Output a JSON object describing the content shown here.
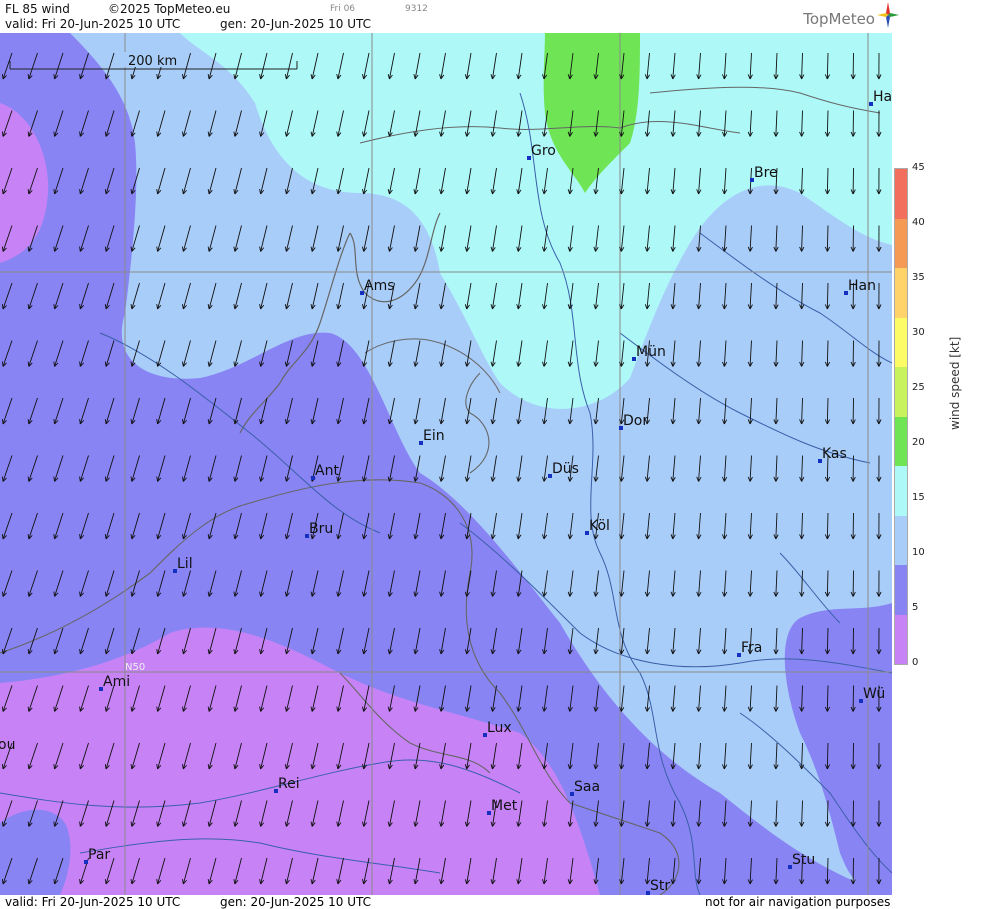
{
  "header": {
    "title": "FL 85 wind",
    "copyright": "©2025 TopMeteo.eu",
    "run_code": "Fri 06",
    "product_code": "9312",
    "valid": "valid:  Fri  20-Jun-2025  10 UTC",
    "generated": "gen:  20-Jun-2025  10 UTC",
    "brand": "TopMeteo"
  },
  "map": {
    "scale_label": "200 km",
    "lat_label": "N50",
    "cities": [
      {
        "code": "Ha"
      },
      {
        "code": "Gro"
      },
      {
        "code": "Bre"
      },
      {
        "code": "Ams"
      },
      {
        "code": "Han"
      },
      {
        "code": "Mün"
      },
      {
        "code": "Dor"
      },
      {
        "code": "Ein"
      },
      {
        "code": "Düs"
      },
      {
        "code": "Kas"
      },
      {
        "code": "Ant"
      },
      {
        "code": "Bru"
      },
      {
        "code": "Köl"
      },
      {
        "code": "Lil"
      },
      {
        "code": "Fra"
      },
      {
        "code": "Ami"
      },
      {
        "code": "Wü"
      },
      {
        "code": "Lux"
      },
      {
        "code": "ou"
      },
      {
        "code": "Rei"
      },
      {
        "code": "Saa"
      },
      {
        "code": "Met"
      },
      {
        "code": "Par"
      },
      {
        "code": "Stu"
      },
      {
        "code": "Str"
      }
    ]
  },
  "legend": {
    "title": "wind  speed  [kt]",
    "ticks": [
      "45",
      "40",
      "35",
      "30",
      "25",
      "20",
      "15",
      "10",
      "5",
      "0"
    ],
    "colors": [
      "#f36f5d",
      "#f59a55",
      "#ffd36a",
      "#fdfb66",
      "#c8f25e",
      "#6fe556",
      "#aef8f8",
      "#a9cdf9",
      "#8884f4",
      "#c783f6"
    ]
  },
  "footer": {
    "valid": "valid:  Fri  20-Jun-2025  10 UTC",
    "generated": "gen:  20-Jun-2025  10 UTC",
    "disclaimer": "not for air navigation purposes"
  }
}
